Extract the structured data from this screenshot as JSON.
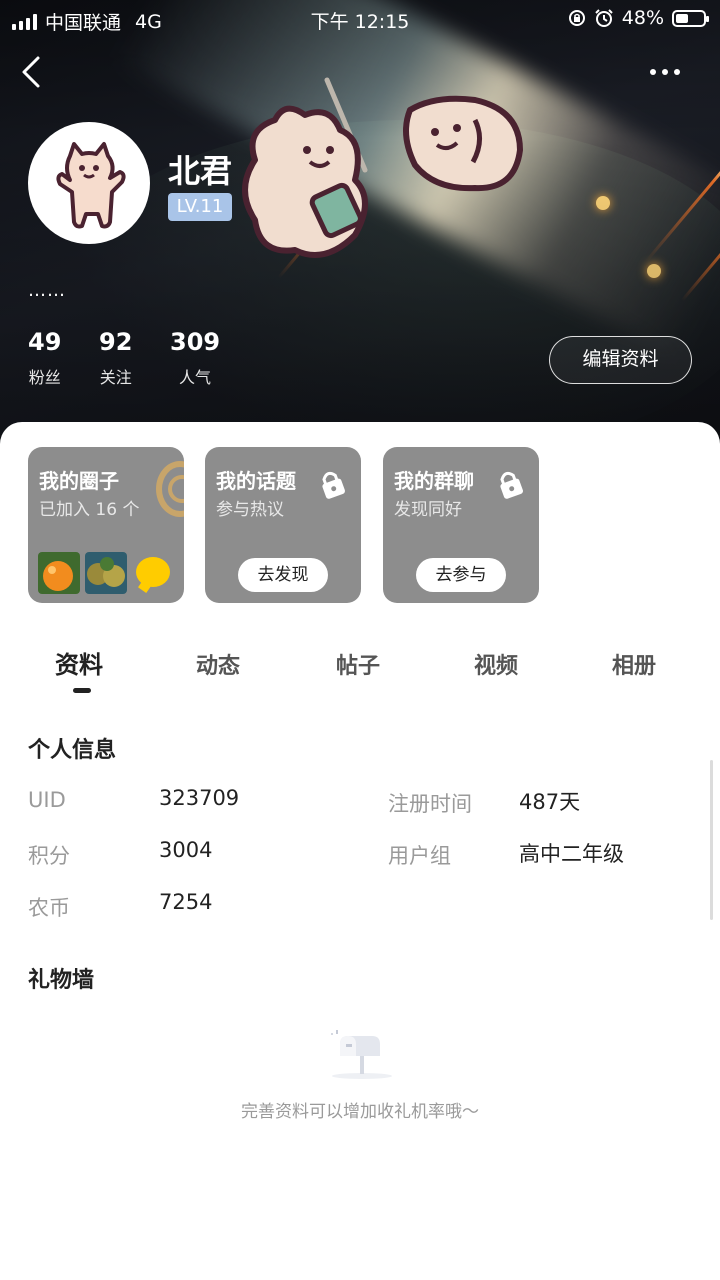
{
  "status_bar": {
    "carrier": "中国联通",
    "network": "4G",
    "time": "下午 12:15",
    "battery": "48%",
    "battery_level": 0.48
  },
  "nav": {
    "back_icon": "chevron-left-icon",
    "more_icon": "more-dots-icon"
  },
  "profile": {
    "username": "北君",
    "level": "LV.11",
    "signature": "……",
    "stats": [
      {
        "value": "49",
        "label": "粉丝"
      },
      {
        "value": "92",
        "label": "关注"
      },
      {
        "value": "309",
        "label": "人气"
      }
    ],
    "edit_label": "编辑资料"
  },
  "cards": [
    {
      "title": "我的圈子",
      "subtitle": "已加入 16 个"
    },
    {
      "title": "我的话题",
      "subtitle": "参与热议",
      "action": "去发现",
      "icon": "lock-icon"
    },
    {
      "title": "我的群聊",
      "subtitle": "发现同好",
      "action": "去参与",
      "icon": "lock-icon"
    }
  ],
  "tabs": [
    "资料",
    "动态",
    "帖子",
    "视频",
    "相册"
  ],
  "active_tab": 0,
  "info": {
    "title": "个人信息",
    "left": [
      {
        "label": "UID",
        "value": "323709"
      },
      {
        "label": "积分",
        "value": "3004"
      },
      {
        "label": "农币",
        "value": "7254"
      }
    ],
    "right": [
      {
        "label": "注册时间",
        "value": "487天"
      },
      {
        "label": "用户组",
        "value": "高中二年级"
      }
    ]
  },
  "gift_wall": {
    "title": "礼物墙",
    "empty_text": "完善资料可以增加收礼机率哦～",
    "empty_icon": "mailbox-icon"
  },
  "colors": {
    "level_badge": "#a9c4e8",
    "card_bg": "#8d8d8d",
    "accent_text": "#222222",
    "muted_text": "#9a9a9a"
  }
}
